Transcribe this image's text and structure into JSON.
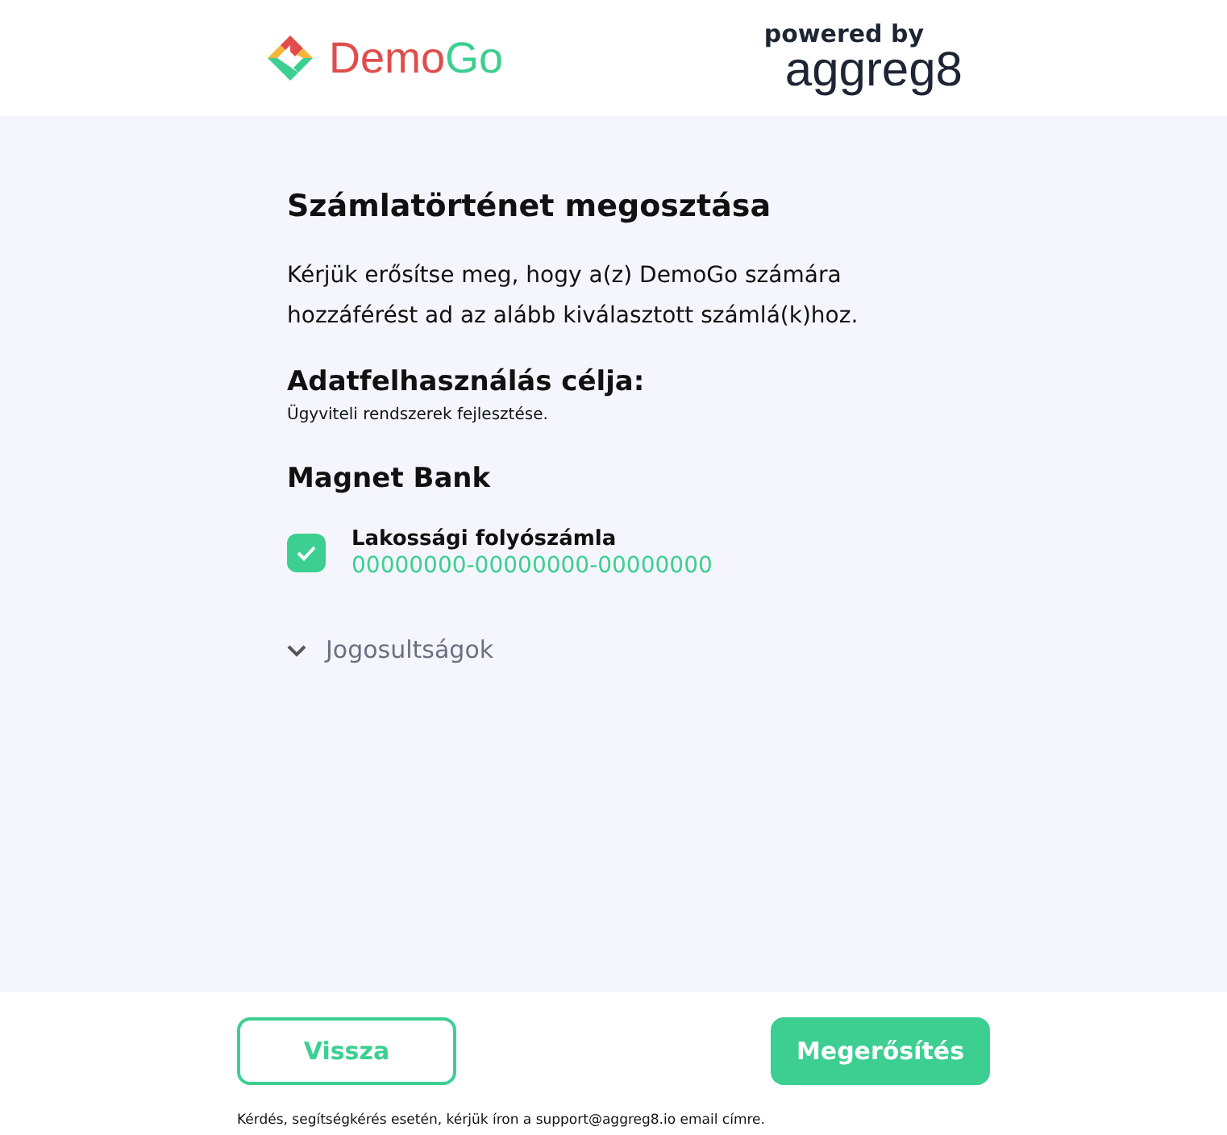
{
  "header": {
    "brand_first": "Demo",
    "brand_second": "Go",
    "powered_by": "powered by",
    "partner": "aggreg8"
  },
  "title": "Számlatörténet megosztása",
  "intro": "Kérjük erősítse meg, hogy a(z) DemoGo számára hozzáférést ad az alább kiválasztott számlá(k)hoz.",
  "purpose": {
    "heading": "Adatfelhasználás célja:",
    "text": "Ügyviteli rendszerek fejlesztése."
  },
  "bank": {
    "name": "Magnet Bank",
    "accounts": [
      {
        "name": "Lakossági folyószámla",
        "number": "00000000-00000000-00000000",
        "checked": true
      }
    ]
  },
  "permissions": {
    "label": "Jogosultságok",
    "expanded": false
  },
  "buttons": [
    {
      "label": "Vissza",
      "kind": "secondary"
    },
    {
      "label": "Megerősítés",
      "kind": "primary"
    }
  ],
  "footer_note": "Kérdés, segítségkérés esetén, kérjük íron a support@aggreg8.io email címre."
}
